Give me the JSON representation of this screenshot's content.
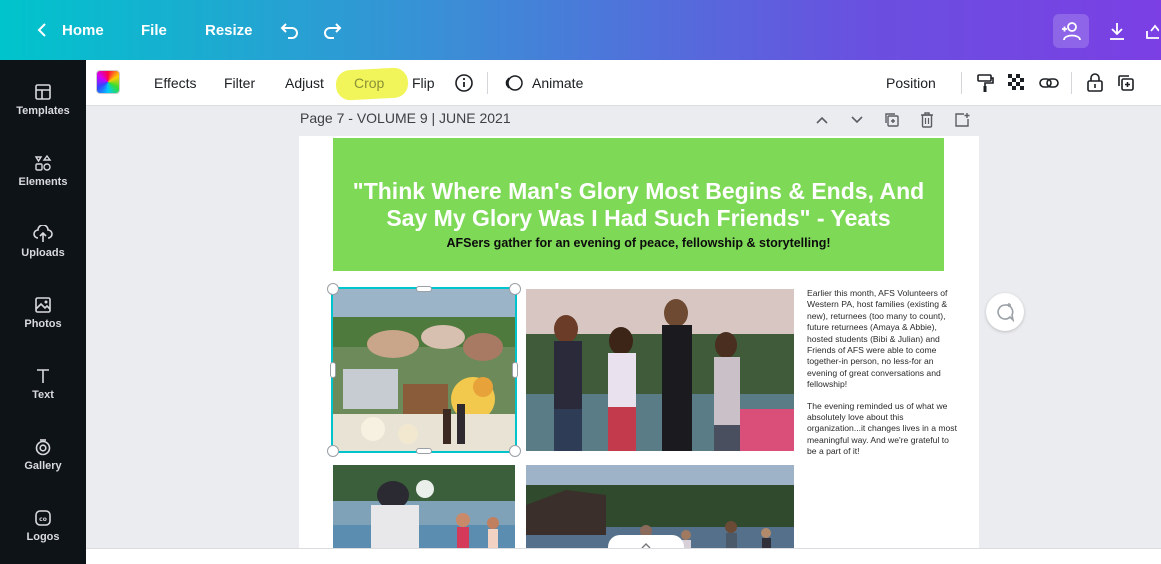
{
  "topbar": {
    "home_label": "Home",
    "file_label": "File",
    "resize_label": "Resize",
    "undo_icon": "undo-icon",
    "redo_icon": "redo-icon",
    "right_icons": [
      "share-people-icon",
      "download-icon",
      "more-icon"
    ]
  },
  "sidebar": {
    "items": [
      {
        "label": "Templates",
        "icon": "templates-icon"
      },
      {
        "label": "Elements",
        "icon": "elements-icon"
      },
      {
        "label": "Uploads",
        "icon": "upload-cloud-icon"
      },
      {
        "label": "Photos",
        "icon": "photos-icon"
      },
      {
        "label": "Text",
        "icon": "text-icon"
      },
      {
        "label": "Gallery",
        "icon": "gallery-icon"
      },
      {
        "label": "Logos",
        "icon": "logos-icon"
      }
    ]
  },
  "toolbar": {
    "effects_label": "Effects",
    "filter_label": "Filter",
    "adjust_label": "Adjust",
    "crop_label": "Crop",
    "flip_label": "Flip",
    "animate_label": "Animate",
    "position_label": "Position",
    "highlight_color": "#f1f55a"
  },
  "page": {
    "label": "Page 7 - VOLUME 9 | JUNE 2021",
    "banner_title_line1": "\"Think Where Man's Glory Most Begins & Ends, And",
    "banner_title_line2": "Say My Glory Was I Had Such Friends\" - Yeats",
    "banner_subtitle": "AFSers gather for an evening of peace, fellowship & storytelling!",
    "banner_color": "#7ed957",
    "article_p1": "Earlier this month, AFS Volunteers of Western PA, host families (existing & new), returnees (too many to count), future returnees (Amaya & Abbie), hosted students (Bibi & Julian) and Friends of AFS were able to come together-in person, no less-for an evening of great conversations and fellowship!",
    "article_p2": "The evening reminded us of what we absolutely love about this organization...it changes lives in a most meaningful way. And we're grateful to be a part of it!"
  },
  "colors": {
    "selection": "#00c4cc",
    "sidebar_bg": "#0e1318"
  }
}
